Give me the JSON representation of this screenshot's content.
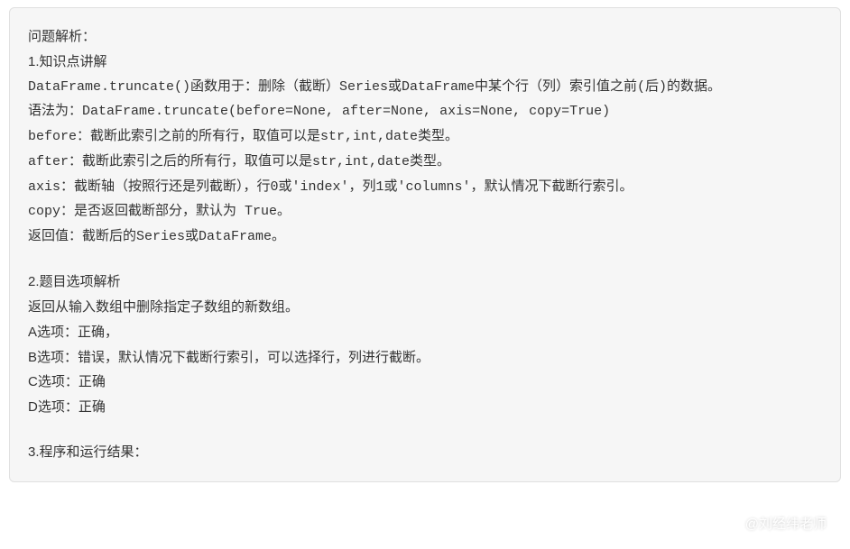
{
  "explanation": {
    "title": "问题解析：",
    "section1": {
      "heading": "1.知识点讲解",
      "line1": "DataFrame.truncate()函数用于：删除（截断）Series或DataFrame中某个行（列）索引值之前(后)的数据。",
      "line2": "语法为：DataFrame.truncate(before=None, after=None, axis=None, copy=True)",
      "line3": "before：截断此索引之前的所有行，取值可以是str,int,date类型。",
      "line4": "after：截断此索引之后的所有行，取值可以是str,int,date类型。",
      "line5": "axis：截断轴（按照行还是列截断），行0或'index'，列1或'columns'，默认情况下截断行索引。",
      "line6": "copy：是否返回截断部分，默认为 True。",
      "line7": "返回值：截断后的Series或DataFrame。"
    },
    "section2": {
      "heading": "2.题目选项解析",
      "intro": "返回从输入数组中删除指定子数组的新数组。",
      "optA": "A选项：正确，",
      "optB": "B选项：错误，默认情况下截断行索引，可以选择行，列进行截断。",
      "optC": "C选项：正确",
      "optD": "D选项：正确"
    },
    "section3": {
      "heading": "3.程序和运行结果："
    }
  },
  "watermark": {
    "text": "@刘经纬老师"
  }
}
